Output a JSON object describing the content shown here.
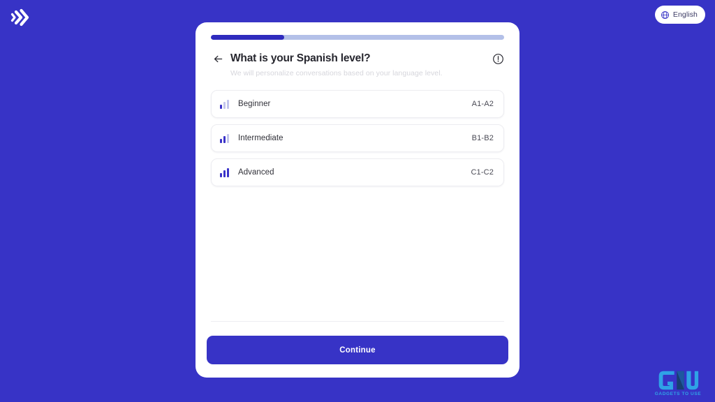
{
  "brand": {
    "logo_icon": "soundwave-logo-icon"
  },
  "language_selector": {
    "icon": "globe-icon",
    "label": "English"
  },
  "card": {
    "progress": {
      "percent": 25
    },
    "back_icon": "arrow-left-icon",
    "title": "What is your Spanish level?",
    "info_icon": "info-circle-icon",
    "subtitle": "We will personalize conversations based on your language level.",
    "options": [
      {
        "icon": "signal-bars-icon",
        "level_filled": 1,
        "label": "Beginner",
        "code": "A1-A2"
      },
      {
        "icon": "signal-bars-icon",
        "level_filled": 2,
        "label": "Intermediate",
        "code": "B1-B2"
      },
      {
        "icon": "signal-bars-icon",
        "level_filled": 3,
        "label": "Advanced",
        "code": "C1-C2"
      }
    ],
    "continue_label": "Continue"
  },
  "watermark": {
    "text": "GADGETS TO USE"
  },
  "colors": {
    "background": "#3733c6",
    "accent": "#3b33c9",
    "progress_track": "#b3c0e8",
    "progress_fill": "#2f2bbe",
    "bar_inactive": "#c3c6ec",
    "watermark": "#2fa8e8"
  }
}
